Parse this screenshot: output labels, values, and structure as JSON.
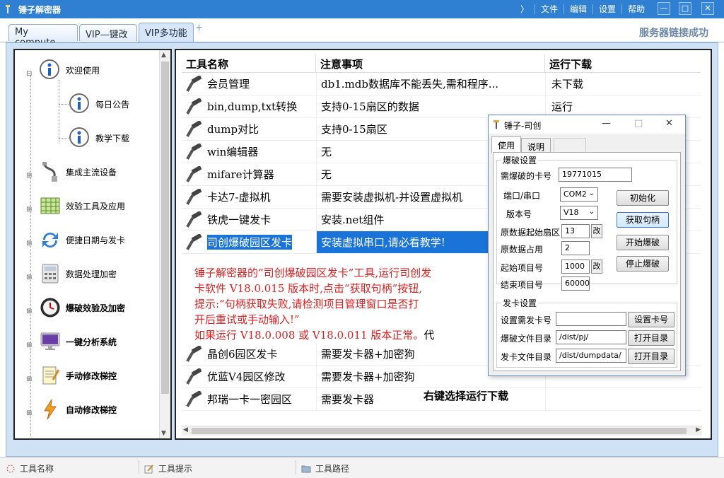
{
  "window": {
    "title": "锤子解密器",
    "menu": [
      "文件",
      "编辑",
      "设置",
      "帮助"
    ],
    "controls": [
      "—",
      "□",
      "✕"
    ]
  },
  "tabs": [
    {
      "label": "My compute"
    },
    {
      "label": "VIP—键改"
    },
    {
      "label": "VIP多功能"
    }
  ],
  "tab_add": "+",
  "server_status": "服务器链接成功",
  "tree": {
    "items": [
      {
        "label": "欢迎使用",
        "icon": "info-icon"
      },
      {
        "label": "每日公告",
        "icon": "info-icon"
      },
      {
        "label": "教学下载",
        "icon": "info-icon"
      },
      {
        "label": "集成主流设备",
        "icon": "usb-cable-icon"
      },
      {
        "label": "效验工具及应用",
        "icon": "spreadsheet-icon"
      },
      {
        "label": "便捷日期与发卡",
        "icon": "sync-icon"
      },
      {
        "label": "数据处理加密",
        "icon": "calculator-icon"
      },
      {
        "label": "爆破效验及加密",
        "icon": "clock-icon"
      },
      {
        "label": "一键分析系统",
        "icon": "monitor-icon"
      },
      {
        "label": "手动修改梯控",
        "icon": "notepad-icon"
      },
      {
        "label": "自动修改梯控",
        "icon": "lightning-icon"
      }
    ]
  },
  "grid": {
    "headers": [
      "工具名称",
      "注意事项",
      "运行下载"
    ],
    "rows": [
      {
        "name": "会员管理",
        "note": "db1.mdb数据库不能丢失,需和程序...",
        "status": "未下载"
      },
      {
        "name": "bin,dump,txt转换",
        "note": "支持0-15扇区的数据",
        "status": "运行"
      },
      {
        "name": "dump对比",
        "note": "支持0-15扇区",
        "status": ""
      },
      {
        "name": "win编辑器",
        "note": "无",
        "status": ""
      },
      {
        "name": "mifare计算器",
        "note": "无",
        "status": ""
      },
      {
        "name": "卡达7-虚拟机",
        "note": "需要安装虚拟机-并设置虚拟机",
        "status": ""
      },
      {
        "name": "铁虎一键发卡",
        "note": "安装.net组件",
        "status": ""
      },
      {
        "name": "司创爆破园区发卡",
        "note": "安装虚拟串口,请必看教学!",
        "status": ""
      }
    ],
    "rows_bottom": [
      {
        "name": "晶创6园区发卡",
        "note": "需要发卡器+加密狗"
      },
      {
        "name": "优蓝V4园区修改",
        "note": "需要发卡器+加密狗"
      },
      {
        "name": "邦瑞一卡一密园区",
        "note": "需要发卡器"
      }
    ],
    "notice_lines": [
      "锤子解密器的“司创爆破园区发卡”工具,运行司创发",
      "卡软件 V18.0.015 版本时,点击“获取句柄”按钮,",
      "提示:“句柄获取失败,请检测项目管理窗口是否打",
      "开后重试或手动输入!”",
      "如果运行 V18.0.008 或 V18.0.011 版本正常。"
    ],
    "notice_tail": "代",
    "hint": "右键选择运行下载"
  },
  "dialog": {
    "title": "锤子-司创",
    "tabs": [
      "使用",
      "说明"
    ],
    "group1_title": "爆破设置",
    "card_label": "需爆破的卡号",
    "card_value": "19771015",
    "port_label": "端口/串口",
    "port_value": "COM2",
    "version_label": "版本号",
    "version_value": "V18",
    "sector_label": "原数据起始扇区",
    "sector_value": "13",
    "usage_label": "原数据占用",
    "usage_value": "2",
    "start_label": "起始项目号",
    "start_value": "1000",
    "end_label": "结束项目号",
    "end_value": "60000",
    "change_btn": "改",
    "init_btn": "初始化",
    "get_handle_btn": "获取句柄",
    "start_btn": "开始爆破",
    "stop_btn": "停止爆破",
    "group2_title": "发卡设置",
    "set_card_label": "设置需发卡号",
    "set_card_btn": "设置卡号",
    "crack_dir_label": "爆破文件目录",
    "crack_dir_value": "/dist/pj/",
    "card_dir_label": "发卡文件目录",
    "card_dir_value": "/dist/dumpdata/",
    "open_dir_btn": "打开目录"
  },
  "statusbar": {
    "items": [
      {
        "label": "工具名称",
        "icon": "tool-icon"
      },
      {
        "label": "工具提示",
        "icon": "edit-icon"
      },
      {
        "label": "工具路径",
        "icon": "folder-icon"
      }
    ]
  },
  "colors": {
    "titlebar": "#2f7fd2",
    "selection": "#1a73d8",
    "notice": "#e02020"
  }
}
